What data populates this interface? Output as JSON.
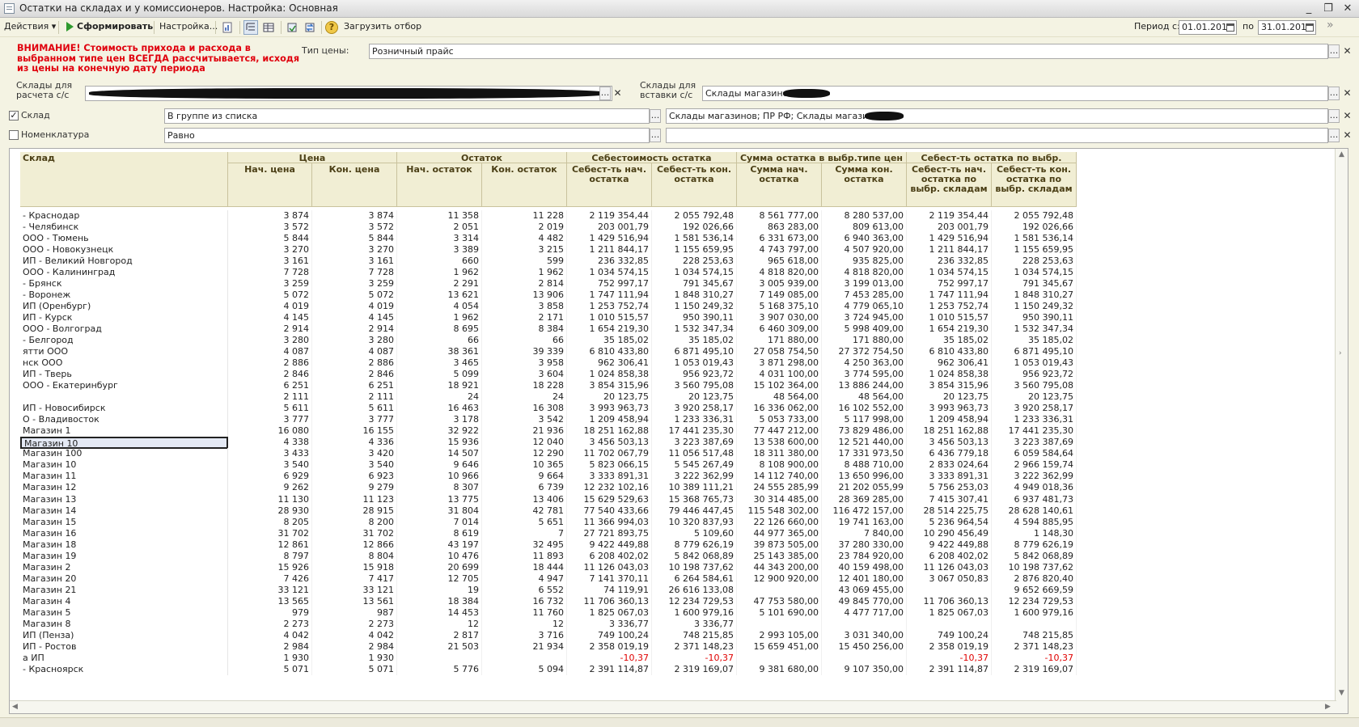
{
  "window": {
    "title": "Остатки на складах и у комиссионеров. Настройка: Основная"
  },
  "toolbar": {
    "actions_label": "Действия",
    "run_label": "Сформировать",
    "settings_label": "Настройка...",
    "load_filter_label": "Загрузить отбор",
    "period_from_label": "Период с:",
    "period_from_value": "01.01.2014",
    "period_to_label": "по",
    "period_to_value": "31.01.2014"
  },
  "form": {
    "warning": "ВНИМАНИЕ! Стоимость прихода и расхода в выбранном типе цен ВСЕГДА рассчитывается, исходя из цены на конечную дату периода",
    "price_type_label": "Тип цены:",
    "price_type_value": "Розничный прайс",
    "calc_warehouses_label": "Склады для расчета с/с",
    "calc_warehouses_value": "",
    "insert_warehouses_label": "Склады для вставки с/с",
    "insert_warehouses_value": "Склады магазинов",
    "warehouse_filter_label": "Склад",
    "warehouse_filter_checked": true,
    "warehouse_condition": "В группе из списка",
    "warehouse_value": "Склады магазинов; ПР РФ; Склады магазинов",
    "nomenclature_filter_label": "Номенклатура",
    "nomenclature_filter_checked": false,
    "nomenclature_condition": "Равно",
    "nomenclature_value": ""
  },
  "table": {
    "group_headers": [
      "Склад",
      "Цена",
      "Остаток",
      "Себестоимость остатка",
      "Сумма остатка в выбр.типе цен",
      "Себест-ть остатка по выбр. складам"
    ],
    "sub_headers": [
      "Нач. цена",
      "Кон. цена",
      "Нач. остаток",
      "Кон. остаток",
      "Себест-ть нач. остатка",
      "Себест-ть кон. остатка",
      "Сумма нач. остатка",
      "Сумма кон. остатка",
      "Себест-ть нач. остатка по выбр. складам",
      "Себест-ть кон. остатка по выбр. складам"
    ],
    "selected_row": 20,
    "rows": [
      [
        "- Краснодар",
        "3 874",
        "3 874",
        "11 358",
        "11 228",
        "2 119 354,44",
        "2 055 792,48",
        "8 561 777,00",
        "8 280 537,00",
        "2 119 354,44",
        "2 055 792,48"
      ],
      [
        "- Челябинск",
        "3 572",
        "3 572",
        "2 051",
        "2 019",
        "203 001,79",
        "192 026,66",
        "863 283,00",
        "809 613,00",
        "203 001,79",
        "192 026,66"
      ],
      [
        "ООО - Тюмень",
        "5 844",
        "5 844",
        "3 314",
        "4 482",
        "1 429 516,94",
        "1 581 536,14",
        "6 331 673,00",
        "6 940 363,00",
        "1 429 516,94",
        "1 581 536,14"
      ],
      [
        "ООО - Новокузнецк",
        "3 270",
        "3 270",
        "3 389",
        "3 215",
        "1 211 844,17",
        "1 155 659,95",
        "4 743 797,00",
        "4 507 920,00",
        "1 211 844,17",
        "1 155 659,95"
      ],
      [
        "ИП - Великий Новгород",
        "3 161",
        "3 161",
        "660",
        "599",
        "236 332,85",
        "228 253,63",
        "965 618,00",
        "935 825,00",
        "236 332,85",
        "228 253,63"
      ],
      [
        "ООО - Калининград",
        "7 728",
        "7 728",
        "1 962",
        "1 962",
        "1 034 574,15",
        "1 034 574,15",
        "4 818 820,00",
        "4 818 820,00",
        "1 034 574,15",
        "1 034 574,15"
      ],
      [
        "- Брянск",
        "3 259",
        "3 259",
        "2 291",
        "2 814",
        "752 997,17",
        "791 345,67",
        "3 005 939,00",
        "3 199 013,00",
        "752 997,17",
        "791 345,67"
      ],
      [
        "- Воронеж",
        "5 072",
        "5 072",
        "13 621",
        "13 906",
        "1 747 111,94",
        "1 848 310,27",
        "7 149 085,00",
        "7 453 285,00",
        "1 747 111,94",
        "1 848 310,27"
      ],
      [
        "ИП (Оренбург)",
        "4 019",
        "4 019",
        "4 054",
        "3 858",
        "1 253 752,74",
        "1 150 249,32",
        "5 168 375,10",
        "4 779 065,10",
        "1 253 752,74",
        "1 150 249,32"
      ],
      [
        "ИП - Курск",
        "4 145",
        "4 145",
        "1 962",
        "2 171",
        "1 010 515,57",
        "950 390,11",
        "3 907 030,00",
        "3 724 945,00",
        "1 010 515,57",
        "950 390,11"
      ],
      [
        "ООО - Волгоград",
        "2 914",
        "2 914",
        "8 695",
        "8 384",
        "1 654 219,30",
        "1 532 347,34",
        "6 460 309,00",
        "5 998 409,00",
        "1 654 219,30",
        "1 532 347,34"
      ],
      [
        "- Белгород",
        "3 280",
        "3 280",
        "66",
        "66",
        "35 185,02",
        "35 185,02",
        "171 880,00",
        "171 880,00",
        "35 185,02",
        "35 185,02"
      ],
      [
        "ятти ООО",
        "4 087",
        "4 087",
        "38 361",
        "39 339",
        "6 810 433,80",
        "6 871 495,10",
        "27 058 754,50",
        "27 372 754,50",
        "6 810 433,80",
        "6 871 495,10"
      ],
      [
        "нск ООО",
        "2 886",
        "2 886",
        "3 465",
        "3 958",
        "962 306,41",
        "1 053 019,43",
        "3 871 298,00",
        "4 250 363,00",
        "962 306,41",
        "1 053 019,43"
      ],
      [
        "ИП - Тверь",
        "2 846",
        "2 846",
        "5 099",
        "3 604",
        "1 024 858,38",
        "956 923,72",
        "4 031 100,00",
        "3 774 595,00",
        "1 024 858,38",
        "956 923,72"
      ],
      [
        "ООО - Екатеринбург",
        "6 251",
        "6 251",
        "18 921",
        "18 228",
        "3 854 315,96",
        "3 560 795,08",
        "15 102 364,00",
        "13 886 244,00",
        "3 854 315,96",
        "3 560 795,08"
      ],
      [
        "",
        "2 111",
        "2 111",
        "24",
        "24",
        "20 123,75",
        "20 123,75",
        "48 564,00",
        "48 564,00",
        "20 123,75",
        "20 123,75"
      ],
      [
        "ИП - Новосибирск",
        "5 611",
        "5 611",
        "16 463",
        "16 308",
        "3 993 963,73",
        "3 920 258,17",
        "16 336 062,00",
        "16 102 552,00",
        "3 993 963,73",
        "3 920 258,17"
      ],
      [
        "О - Владивосток",
        "3 777",
        "3 777",
        "3 178",
        "3 542",
        "1 209 458,94",
        "1 233 336,31",
        "5 053 733,00",
        "5 117 998,00",
        "1 209 458,94",
        "1 233 336,31"
      ],
      [
        "Магазин 1",
        "16 080",
        "16 155",
        "32 922",
        "21 936",
        "18 251 162,88",
        "17 441 235,30",
        "77 447 212,00",
        "73 829 486,00",
        "18 251 162,88",
        "17 441 235,30"
      ],
      [
        "Магазин 10",
        "4 338",
        "4 336",
        "15 936",
        "12 040",
        "3 456 503,13",
        "3 223 387,69",
        "13 538 600,00",
        "12 521 440,00",
        "3 456 503,13",
        "3 223 387,69"
      ],
      [
        "Магазин 100",
        "3 433",
        "3 420",
        "14 507",
        "12 290",
        "11 702 067,79",
        "11 056 517,48",
        "18 311 380,00",
        "17 331 973,50",
        "6 436 779,18",
        "6 059 584,64"
      ],
      [
        "Магазин 10",
        "3 540",
        "3 540",
        "9 646",
        "10 365",
        "5 823 066,15",
        "5 545 267,49",
        "8 108 900,00",
        "8 488 710,00",
        "2 833 024,64",
        "2 966 159,74"
      ],
      [
        "Магазин 11",
        "6 929",
        "6 923",
        "10 966",
        "9 664",
        "3 333 891,31",
        "3 222 362,99",
        "14 112 740,00",
        "13 650 996,00",
        "3 333 891,31",
        "3 222 362,99"
      ],
      [
        "Магазин 12",
        "9 262",
        "9 279",
        "8 307",
        "6 739",
        "12 232 102,16",
        "10 389 111,21",
        "24 555 285,99",
        "21 202 055,99",
        "5 756 253,03",
        "4 949 018,36"
      ],
      [
        "Магазин 13",
        "11 130",
        "11 123",
        "13 775",
        "13 406",
        "15 629 529,63",
        "15 368 765,73",
        "30 314 485,00",
        "28 369 285,00",
        "7 415 307,41",
        "6 937 481,73"
      ],
      [
        "Магазин 14",
        "28 930",
        "28 915",
        "31 804",
        "42 781",
        "77 540 433,66",
        "79 446 447,45",
        "115 548 302,00",
        "116 472 157,00",
        "28 514 225,75",
        "28 628 140,61"
      ],
      [
        "Магазин 15",
        "8 205",
        "8 200",
        "7 014",
        "5 651",
        "11 366 994,03",
        "10 320 837,93",
        "22 126 660,00",
        "19 741 163,00",
        "5 236 964,54",
        "4 594 885,95"
      ],
      [
        "Магазин 16",
        "31 702",
        "31 702",
        "8 619",
        "7",
        "27 721 893,75",
        "5 109,60",
        "44 977 365,00",
        "7 840,00",
        "10 290 456,49",
        "1 148,30"
      ],
      [
        "Магазин 18",
        "12 861",
        "12 866",
        "43 197",
        "32 495",
        "9 422 449,88",
        "8 779 626,19",
        "39 873 505,00",
        "37 280 330,00",
        "9 422 449,88",
        "8 779 626,19"
      ],
      [
        "Магазин 19",
        "8 797",
        "8 804",
        "10 476",
        "11 893",
        "6 208 402,02",
        "5 842 068,89",
        "25 143 385,00",
        "23 784 920,00",
        "6 208 402,02",
        "5 842 068,89"
      ],
      [
        "Магазин 2",
        "15 926",
        "15 918",
        "20 699",
        "18 444",
        "11 126 043,03",
        "10 198 737,62",
        "44 343 200,00",
        "40 159 498,00",
        "11 126 043,03",
        "10 198 737,62"
      ],
      [
        "Магазин 20",
        "7 426",
        "7 417",
        "12 705",
        "4 947",
        "7 141 370,11",
        "6 264 584,61",
        "12 900 920,00",
        "12 401 180,00",
        "3 067 050,83",
        "2 876 820,40"
      ],
      [
        "Магазин 21",
        "33 121",
        "33 121",
        "19",
        "6 552",
        "74 119,91",
        "26 616 133,08",
        "",
        "43 069 455,00",
        "",
        "9 652 669,59"
      ],
      [
        "Магазин 4",
        "13 565",
        "13 561",
        "18 384",
        "16 732",
        "11 706 360,13",
        "12 234 729,53",
        "47 753 580,00",
        "49 845 770,00",
        "11 706 360,13",
        "12 234 729,53"
      ],
      [
        "Магазин 5",
        "979",
        "987",
        "14 453",
        "11 760",
        "1 825 067,03",
        "1 600 979,16",
        "5 101 690,00",
        "4 477 717,00",
        "1 825 067,03",
        "1 600 979,16"
      ],
      [
        "Магазин 8",
        "2 273",
        "2 273",
        "12",
        "12",
        "3 336,77",
        "3 336,77",
        "",
        "",
        "",
        ""
      ],
      [
        "ИП (Пенза)",
        "4 042",
        "4 042",
        "2 817",
        "3 716",
        "749 100,24",
        "748 215,85",
        "2 993 105,00",
        "3 031 340,00",
        "749 100,24",
        "748 215,85"
      ],
      [
        "ИП - Ростов",
        "2 984",
        "2 984",
        "21 503",
        "21 934",
        "2 358 019,19",
        "2 371 148,23",
        "15 659 451,00",
        "15 450 256,00",
        "2 358 019,19",
        "2 371 148,23"
      ],
      [
        "а ИП",
        "1 930",
        "1 930",
        "",
        "",
        "-10,37",
        "-10,37",
        "",
        "",
        "-10,37",
        "-10,37"
      ],
      [
        "- Красноярск",
        "5 071",
        "5 071",
        "5 776",
        "5 094",
        "2 391 114,87",
        "2 319 169,07",
        "9 381 680,00",
        "9 107 350,00",
        "2 391 114,87",
        "2 319 169,07"
      ]
    ]
  },
  "colors": {
    "warning": "#e0000d",
    "header_bg": "#f1eed4",
    "window_bg": "#f4f3e3",
    "negative": "#e00000"
  }
}
